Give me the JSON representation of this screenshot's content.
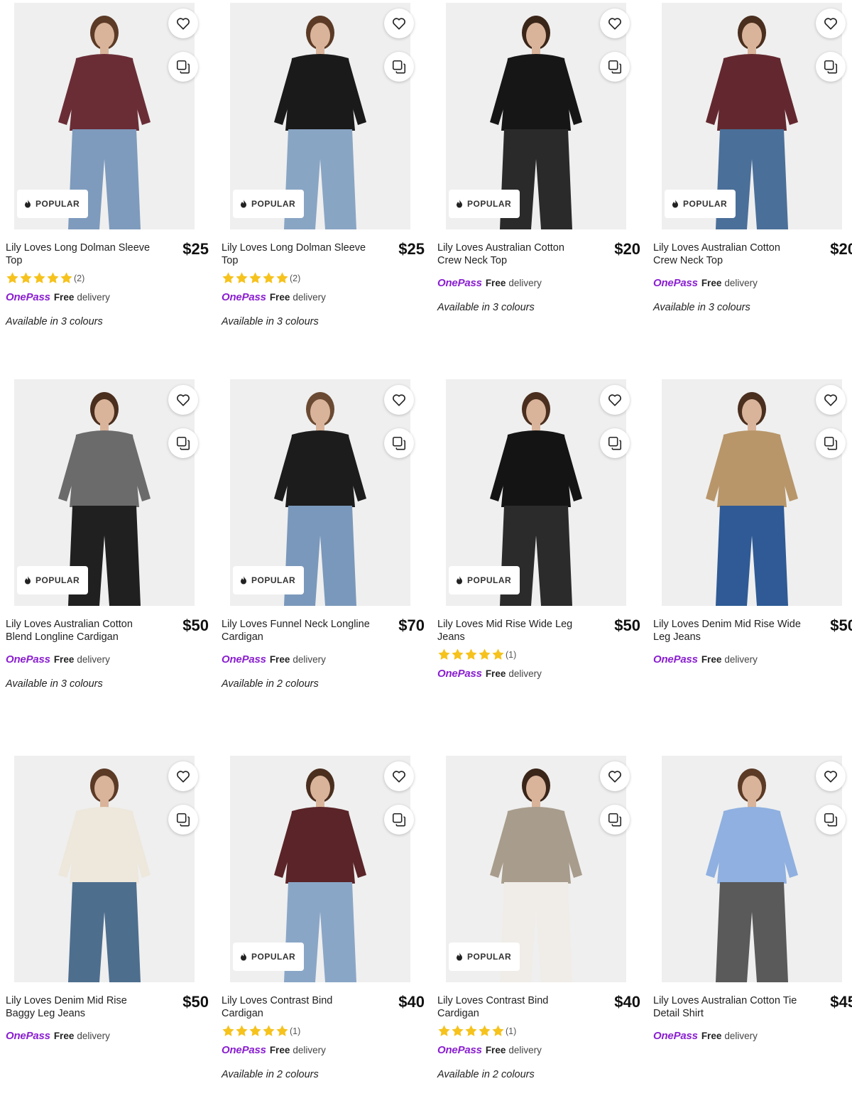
{
  "ui": {
    "popular_label": "POPULAR",
    "onepass_logo": "OnePass",
    "free_label": "Free",
    "delivery_label": "delivery",
    "brand_purple": "#8a1fd1",
    "star_color": "#f6c21c"
  },
  "products": [
    {
      "title": "Lily Loves Long Dolman Sleeve Top",
      "price": "$25",
      "popular": true,
      "rating_count": "(2)",
      "rating": 5,
      "colours": "Available in 3 colours",
      "top": "#6a2d36",
      "bottom": "#7e9bbd",
      "hair": "#5b3a26"
    },
    {
      "title": "Lily Loves Long Dolman Sleeve Top",
      "price": "$25",
      "popular": true,
      "rating_count": "(2)",
      "rating": 5,
      "colours": "Available in 3 colours",
      "top": "#1a1a1a",
      "bottom": "#89a5c4",
      "hair": "#5b3a26"
    },
    {
      "title": "Lily Loves Australian Cotton Crew Neck Top",
      "price": "$20",
      "popular": true,
      "rating_count": null,
      "colours": "Available in 3 colours",
      "top": "#161616",
      "bottom": "#2a2a2a",
      "hair": "#3a2519"
    },
    {
      "title": "Lily Loves Australian Cotton Crew Neck Top",
      "price": "$20",
      "popular": true,
      "rating_count": null,
      "colours": "Available in 3 colours",
      "top": "#63282f",
      "bottom": "#4a6f99",
      "hair": "#4a2e1e"
    },
    {
      "title": "Lily Loves Australian Cotton Blend Longline Cardigan",
      "price": "$50",
      "popular": true,
      "rating_count": null,
      "colours": "Available in 3 colours",
      "top": "#6b6b6b",
      "bottom": "#202020",
      "hair": "#4a2e1e"
    },
    {
      "title": "Lily Loves Funnel Neck Longline Cardigan",
      "price": "$70",
      "popular": true,
      "rating_count": null,
      "colours": "Available in 2 colours",
      "top": "#1c1c1c",
      "bottom": "#7a98bb",
      "hair": "#6a4a32"
    },
    {
      "title": "Lily Loves Mid Rise Wide Leg Jeans",
      "price": "$50",
      "popular": true,
      "rating_count": "(1)",
      "rating": 5,
      "colours": null,
      "top": "#141414",
      "bottom": "#2b2b2b",
      "hair": "#4a2e1e"
    },
    {
      "title": "Lily Loves Denim Mid Rise Wide Leg Jeans",
      "price": "$50",
      "popular": false,
      "rating_count": null,
      "colours": null,
      "top": "#b8966a",
      "bottom": "#2f5a95",
      "hair": "#4a2e1e"
    },
    {
      "title": "Lily Loves Denim Mid Rise Baggy Leg Jeans",
      "price": "$50",
      "popular": false,
      "rating_count": null,
      "colours": null,
      "top": "#ede7dc",
      "bottom": "#4e6e8e",
      "hair": "#5b3a26"
    },
    {
      "title": "Lily Loves Contrast Bind Cardigan",
      "price": "$40",
      "popular": true,
      "rating_count": "(1)",
      "rating": 5,
      "colours": "Available in 2 colours",
      "top": "#5a2428",
      "bottom": "#8aa6c7",
      "hair": "#4a2e1e"
    },
    {
      "title": "Lily Loves Contrast Bind Cardigan",
      "price": "$40",
      "popular": true,
      "rating_count": "(1)",
      "rating": 5,
      "colours": "Available in 2 colours",
      "top": "#a89c8c",
      "bottom": "#f0ede8",
      "hair": "#3a2519"
    },
    {
      "title": "Lily Loves Australian Cotton Tie Detail Shirt",
      "price": "$45",
      "popular": false,
      "rating_count": null,
      "colours": null,
      "top": "#8fb0e0",
      "bottom": "#5a5a5a",
      "hair": "#5b3a26"
    }
  ]
}
